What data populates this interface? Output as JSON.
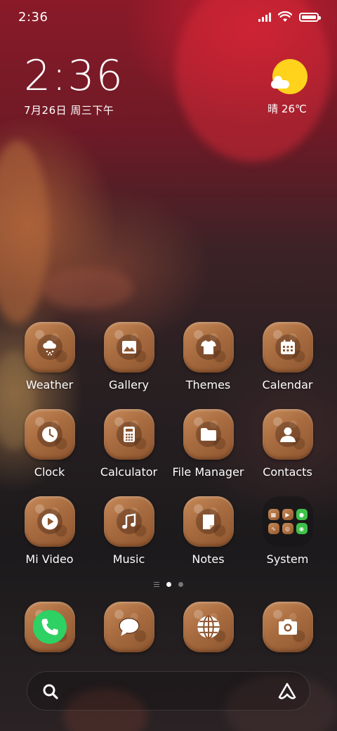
{
  "status_bar": {
    "time": "2:36"
  },
  "clock_widget": {
    "time": "2:36",
    "date": "7月26日 周三下午"
  },
  "weather_widget": {
    "condition_temp": "晴 26℃",
    "icon": "sunny-cloud-icon"
  },
  "apps": [
    {
      "label": "Weather",
      "icon": "weather-snow-cloud-icon"
    },
    {
      "label": "Gallery",
      "icon": "image-icon"
    },
    {
      "label": "Themes",
      "icon": "tshirt-icon"
    },
    {
      "label": "Calendar",
      "icon": "calendar-icon"
    },
    {
      "label": "Clock",
      "icon": "clock-icon"
    },
    {
      "label": "Calculator",
      "icon": "calculator-icon"
    },
    {
      "label": "File Manager",
      "icon": "folder-icon"
    },
    {
      "label": "Contacts",
      "icon": "person-icon"
    },
    {
      "label": "Mi Video",
      "icon": "play-icon"
    },
    {
      "label": "Music",
      "icon": "music-note-icon"
    },
    {
      "label": "Notes",
      "icon": "note-icon"
    },
    {
      "label": "System",
      "icon": "folder-group-icon"
    }
  ],
  "page_indicator": {
    "pages": 2,
    "current": 1
  },
  "dock": [
    {
      "name": "Phone",
      "icon": "phone-icon"
    },
    {
      "name": "Messages",
      "icon": "chat-bubble-icon"
    },
    {
      "name": "Browser",
      "icon": "globe-icon"
    },
    {
      "name": "Camera",
      "icon": "camera-icon"
    }
  ],
  "search_bar": {
    "left_icon": "search-icon",
    "right_icon": "assistant-icon"
  },
  "colors": {
    "sun": "#ffd21c",
    "phone_green": "#2ed163",
    "tile_brown": "#a86c40"
  }
}
